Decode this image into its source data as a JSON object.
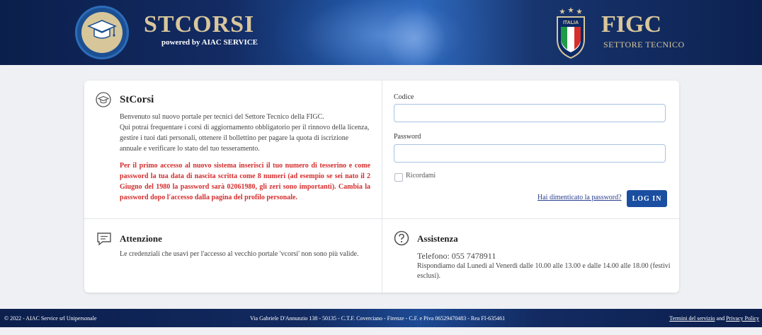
{
  "header": {
    "brand_title": "STCORSI",
    "brand_sub_prefix": "powered by ",
    "brand_sub_strong": "AIAC SERVICE",
    "shield_text": "ITALIA",
    "figc_title": "FIGC",
    "figc_sub": "SETTORE TECNICO"
  },
  "intro": {
    "title": "StCorsi",
    "line1": "Benvenuto sul nuovo portale per tecnici del Settore Tecnico della FIGC.",
    "line2": "Qui potrai frequentare i corsi di aggiornamento obbligatorio per il rinnovo della licenza, gestire i tuoi dati personali, ottenere il bollettino per pagare la quota di iscrizione annuale e verificare lo stato del tuo tesseramento.",
    "warning": "Per il primo accesso al nuovo sistema inserisci il tuo numero di tesserino e come password la tua data di nascita scritta come 8 numeri (ad esempio se sei nato il 2 Giugno del 1980 la password sarà 02061980, gli zeri sono importanti). Cambia la password dopo l'accesso dalla pagina del profilo personale."
  },
  "login": {
    "code_label": "Codice",
    "code_value": "",
    "password_label": "Password",
    "password_value": "",
    "remember_label": "Ricordami",
    "forgot_label": "Hai dimenticato la password?",
    "submit_label": "LOG IN"
  },
  "attention": {
    "title": "Attenzione",
    "text": "Le credenziali che usavi per l'accesso al vecchio portale 'vcorsi' non sono più valide."
  },
  "support": {
    "title": "Assistenza",
    "phone": "Telefono: 055 7478911",
    "hours": "Rispondiamo dal Lunedì al Venerdì dalle 10.00 alle 13.00 e dalle 14.00 alle 18.00 (festivi esclusi)."
  },
  "footer": {
    "copyright": "© 2022 - AIAC Service srl Unipersonale",
    "address": "Via Gabriele D'Annunzio 138 - 50135 - C.T.F. Coverciano - Firenze - C.F. e Piva 06529470483 - Rea FI-635461",
    "terms_label": "Termini del servizio",
    "and_label": " and ",
    "privacy_label": "Privacy Policy"
  },
  "colors": {
    "accent": "#1a4ea1",
    "warning": "#d42d2d",
    "gold": "#d9c79b"
  }
}
